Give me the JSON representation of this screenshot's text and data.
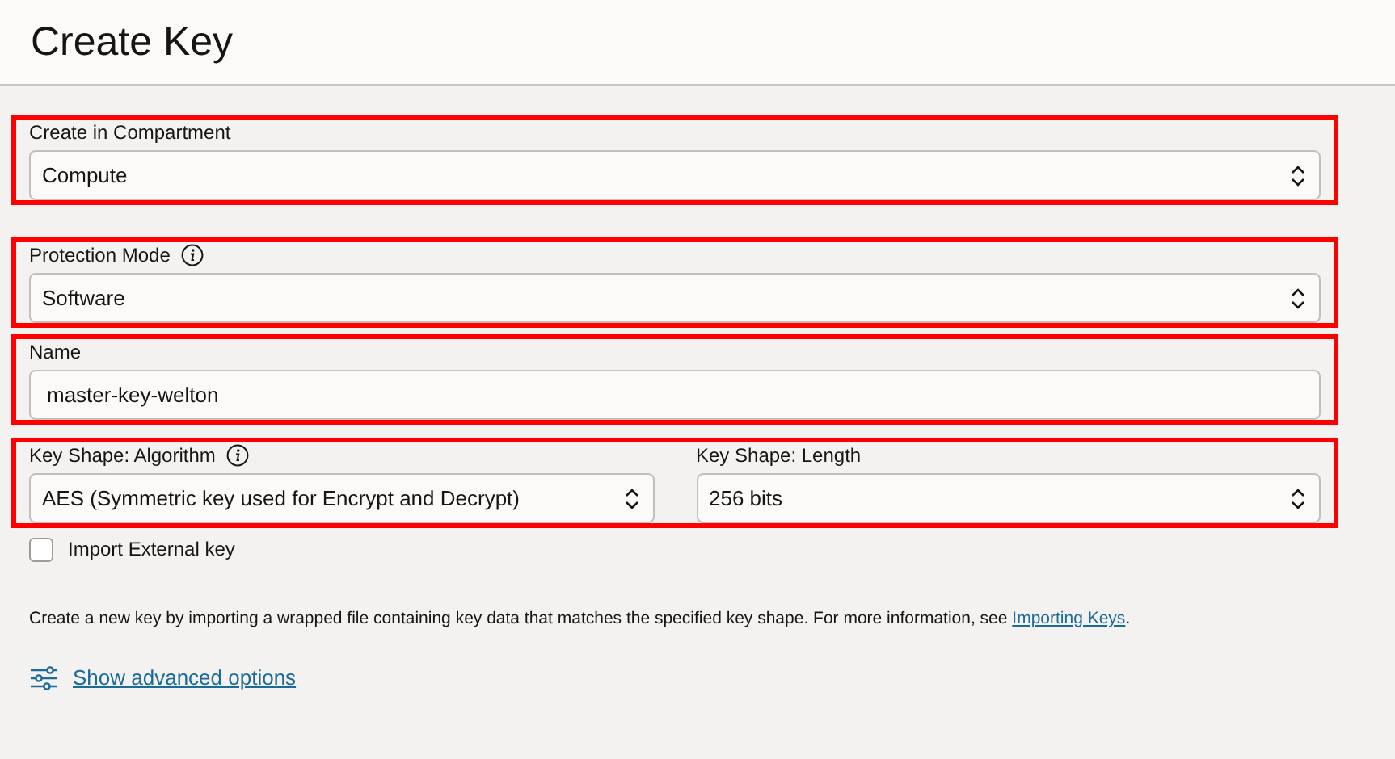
{
  "title": "Create Key",
  "sections": [
    {
      "highlighted": true,
      "fields": [
        {
          "label": "Create in Compartment",
          "info": false,
          "kind": "select",
          "value": "Compute"
        }
      ]
    },
    {
      "highlighted": true,
      "fields": [
        {
          "label": "Protection Mode",
          "info": true,
          "kind": "select",
          "value": "Software"
        }
      ]
    },
    {
      "highlighted": true,
      "fields": [
        {
          "label": "Name",
          "info": false,
          "kind": "text",
          "value": "master-key-welton"
        }
      ]
    },
    {
      "highlighted": true,
      "fields": [
        {
          "label": "Key Shape: Algorithm",
          "info": true,
          "kind": "select",
          "value": "AES (Symmetric key used for Encrypt and Decrypt)"
        },
        {
          "label": "Key Shape: Length",
          "info": false,
          "kind": "select",
          "value": "256 bits"
        }
      ]
    }
  ],
  "import_checkbox": {
    "label": "Import External key",
    "checked": false
  },
  "description": {
    "text": "Create a new key by importing a wrapped file containing key data that matches the specified key shape. For more information, see ",
    "link": "Importing Keys",
    "after": "."
  },
  "advanced_link": "Show advanced options"
}
